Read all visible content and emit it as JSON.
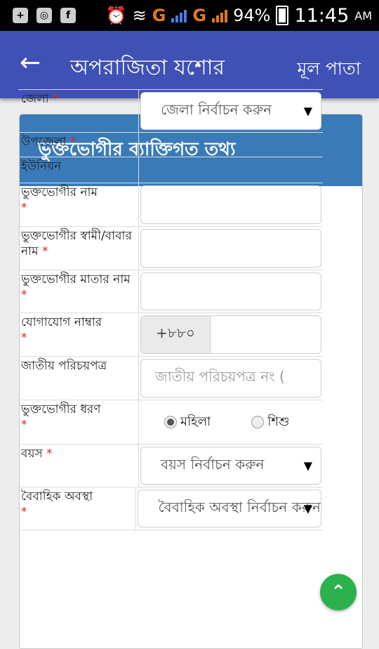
{
  "statusbar": {
    "notification_icons": [
      "chat-bubble-icon",
      "cassette-icon",
      "facebook-icon"
    ],
    "alarm_icon": "alarm-clock-icon",
    "wifi_icon": "wifi-icon",
    "network1": "G",
    "network2": "G",
    "battery_percent": "94%",
    "time": "11:45",
    "ampm": "AM"
  },
  "appbar": {
    "back_icon": "back-arrow-icon",
    "title": "অপরাজিতা যশোর",
    "home_label": "মূল পাতা",
    "color": "#3f51b5"
  },
  "card": {
    "title": "ভুক্তভোগীর ব্যাক্তিগত তথ্য",
    "header_color": "#3a7ab9"
  },
  "form": {
    "district_label": "জেলা",
    "district_value": "জেলা নির্বাচন করুন",
    "upazila_label": "উপজেলা",
    "union_label": "ইউনিয়ন",
    "victim_name_label": "ভুক্তভোগীর নাম",
    "spouse_father_label": "ভুক্তভোগীর স্বামী/বাবার নাম",
    "mother_label": "ভুক্তভোগীর মাতার নাম",
    "contact_label": "যোগাযোগ নাম্বার",
    "phone_prefix": "+৮৮০",
    "nid_label": "জাতীয় পরিচয়পত্র",
    "nid_placeholder": "জাতীয় পরিচয়পত্র নং (",
    "type_label": "ভুক্তভোগীর ধরণ",
    "type_options": [
      "মহিলা",
      "শিশু"
    ],
    "type_selected": "মহিলা",
    "age_label": "বয়স",
    "age_value": "বয়স নির্বাচন করুন",
    "marital_label": "বৈবাহিক অবস্থা",
    "marital_value": "বৈবাহিক অবস্থা নির্বাচন করুন"
  },
  "fab": {
    "icon": "chevron-up-icon",
    "color": "#2bb24c"
  }
}
